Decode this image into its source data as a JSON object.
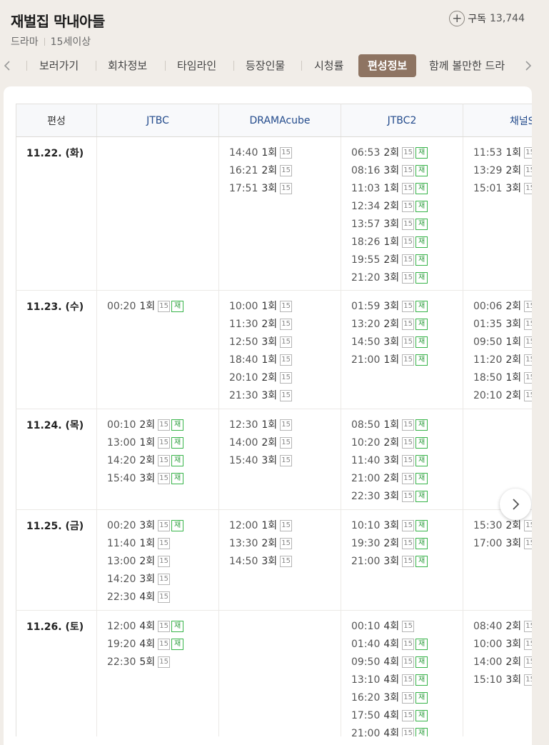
{
  "header": {
    "title": "재벌집 막내아들",
    "genre": "드라마",
    "rating": "15세이상",
    "subscribe_label": "구독",
    "subscribe_count": "13,744"
  },
  "tabs": [
    {
      "label": "보러가기"
    },
    {
      "label": "회차정보"
    },
    {
      "label": "타임라인"
    },
    {
      "label": "등장인물"
    },
    {
      "label": "시청률"
    },
    {
      "label": "편성정보",
      "active": true
    },
    {
      "label": "함께 볼만한 드라"
    }
  ],
  "schedule": {
    "header_label": "편성",
    "channels": [
      "JTBC",
      "DRAMAcube",
      "JTBC2",
      "채널S"
    ],
    "rows": [
      {
        "date": "11.22. (화)",
        "cells": [
          [],
          [
            [
              "14:40",
              "1회",
              false
            ],
            [
              "16:21",
              "2회",
              false
            ],
            [
              "17:51",
              "3회",
              false
            ]
          ],
          [
            [
              "06:53",
              "2회",
              true
            ],
            [
              "08:16",
              "3회",
              true
            ],
            [
              "11:03",
              "1회",
              true
            ],
            [
              "12:34",
              "2회",
              true
            ],
            [
              "13:57",
              "3회",
              true
            ],
            [
              "18:26",
              "1회",
              true
            ],
            [
              "19:55",
              "2회",
              true
            ],
            [
              "21:20",
              "3회",
              true
            ]
          ],
          [
            [
              "11:53",
              "1회",
              true
            ],
            [
              "13:29",
              "2회",
              true
            ],
            [
              "15:01",
              "3회",
              true
            ]
          ]
        ]
      },
      {
        "date": "11.23. (수)",
        "cells": [
          [
            [
              "00:20",
              "1회",
              true
            ]
          ],
          [
            [
              "10:00",
              "1회",
              false
            ],
            [
              "11:30",
              "2회",
              false
            ],
            [
              "12:50",
              "3회",
              false
            ],
            [
              "18:40",
              "1회",
              false
            ],
            [
              "20:10",
              "2회",
              false
            ],
            [
              "21:30",
              "3회",
              false
            ]
          ],
          [
            [
              "01:59",
              "3회",
              true
            ],
            [
              "13:20",
              "2회",
              true
            ],
            [
              "14:50",
              "3회",
              true
            ],
            [
              "21:00",
              "1회",
              true
            ]
          ],
          [
            [
              "00:06",
              "2회",
              true
            ],
            [
              "01:35",
              "3회",
              true
            ],
            [
              "09:50",
              "1회",
              true
            ],
            [
              "11:20",
              "2회",
              true
            ],
            [
              "18:50",
              "1회",
              true
            ],
            [
              "20:10",
              "2회",
              true
            ]
          ]
        ]
      },
      {
        "date": "11.24. (목)",
        "cells": [
          [
            [
              "00:10",
              "2회",
              true
            ],
            [
              "13:00",
              "1회",
              true
            ],
            [
              "14:20",
              "2회",
              true
            ],
            [
              "15:40",
              "3회",
              true
            ]
          ],
          [
            [
              "12:30",
              "1회",
              false
            ],
            [
              "14:00",
              "2회",
              false
            ],
            [
              "15:40",
              "3회",
              false
            ]
          ],
          [
            [
              "08:50",
              "1회",
              true
            ],
            [
              "10:20",
              "2회",
              true
            ],
            [
              "11:40",
              "3회",
              true
            ],
            [
              "21:00",
              "2회",
              true
            ],
            [
              "22:30",
              "3회",
              true
            ]
          ],
          []
        ]
      },
      {
        "date": "11.25. (금)",
        "cells": [
          [
            [
              "00:20",
              "3회",
              true
            ],
            [
              "11:40",
              "1회",
              false
            ],
            [
              "13:00",
              "2회",
              false
            ],
            [
              "14:20",
              "3회",
              false
            ],
            [
              "22:30",
              "4회",
              false
            ]
          ],
          [
            [
              "12:00",
              "1회",
              false
            ],
            [
              "13:30",
              "2회",
              false
            ],
            [
              "14:50",
              "3회",
              false
            ]
          ],
          [
            [
              "10:10",
              "3회",
              true
            ],
            [
              "19:30",
              "2회",
              true
            ],
            [
              "21:00",
              "3회",
              true
            ]
          ],
          [
            [
              "15:30",
              "2회",
              true
            ],
            [
              "17:00",
              "3회",
              true
            ]
          ]
        ]
      },
      {
        "date": "11.26. (토)",
        "cells": [
          [
            [
              "12:00",
              "4회",
              true
            ],
            [
              "19:20",
              "4회",
              true
            ],
            [
              "22:30",
              "5회",
              false
            ]
          ],
          [],
          [
            [
              "00:10",
              "4회",
              false
            ],
            [
              "01:40",
              "4회",
              true
            ],
            [
              "09:50",
              "4회",
              true
            ],
            [
              "13:10",
              "4회",
              true
            ],
            [
              "16:20",
              "3회",
              true
            ],
            [
              "17:50",
              "4회",
              true
            ],
            [
              "21:00",
              "4회",
              true
            ]
          ],
          [
            [
              "08:40",
              "2회",
              true
            ],
            [
              "10:00",
              "3회",
              true
            ],
            [
              "14:00",
              "2회",
              true
            ],
            [
              "15:10",
              "3회",
              true
            ]
          ]
        ]
      }
    ]
  },
  "badges": {
    "age": "15",
    "rerun": "재",
    "rerun_color": "#38b44a",
    "active_tab_color": "#8e7462",
    "channel_header_color": "#234b8c"
  },
  "icons": {
    "subscribe": "plus-circle-icon",
    "tab_prev": "chevron-left-icon",
    "tab_next": "chevron-right-icon",
    "table_next": "chevron-right-icon"
  }
}
